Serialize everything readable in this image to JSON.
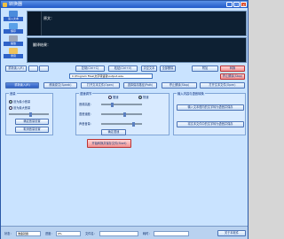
{
  "window": {
    "title": "转换器"
  },
  "lefttool": [
    {
      "label": "读入文本",
      "color": "#4a8bdc",
      "icon": "open-icon"
    },
    {
      "label": "保存",
      "color": "#59a0e8",
      "icon": "save-icon"
    },
    {
      "label": "播放",
      "color": "#9aa4b8",
      "icon": "play-icon"
    },
    {
      "label": "录音",
      "color": "#f0c35a",
      "icon": "record-icon"
    }
  ],
  "editor": {
    "top_label": "原文：",
    "bottom_label": "翻译结果："
  },
  "toolbar": {
    "b1": "复制(Ctrl+C)",
    "b2": "粘贴(Ctrl+V)",
    "b3": "清空文本",
    "b4": "全部删除",
    "b5": "附加",
    "b6": "转换",
    "b_reset": "重新读入(R)",
    "b_speak": "朗读原文(Speak)",
    "b_path": "选择保存路径(Path)",
    "b_stop": "停止朗读(Stop)",
    "b_file": "打开文本文件(Open)"
  },
  "path": {
    "value": "C:\\Program Files\\文字转语音\\output.wav"
  },
  "left_panel": {
    "title": "音量",
    "radio_a": "设为最小音量",
    "radio_b": "设为最大音量",
    "btn_a": "确定音量设置",
    "btn_b": "取消音量设置"
  },
  "middle_panel": {
    "title": "语速调节",
    "radio_a": "慢速",
    "radio_b": "快速",
    "l1": "音调高度：",
    "l2": "语音速度：",
    "l3": "声音音量：",
    "btn": "确定语速"
  },
  "right_panel": {
    "title": "输入内容与语音转换",
    "btn1": "输入文本框内的文字转为语音并保存",
    "btn2": "将文本文件中的文字转为语音并保存"
  },
  "main_btn": {
    "label": "开始转换并保存文件(Start)"
  },
  "status": {
    "l1": "状态：",
    "v1": "准备就绪",
    "l2": "进度：",
    "v2": "0%",
    "l3": "文件名：",
    "v3": "",
    "l4": "耗时：",
    "v4": "",
    "right_btn": "关于本软件"
  }
}
